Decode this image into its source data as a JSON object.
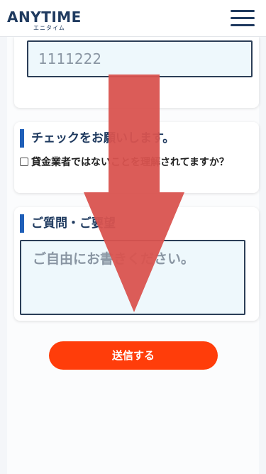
{
  "header": {
    "logo_main": "ANYTIME",
    "logo_sub": "エニタイム",
    "menu_icon": "hamburger-menu-icon"
  },
  "phone_field": {
    "value": "1111222"
  },
  "check_section": {
    "title": "チェックをお願いします。",
    "checkbox_label": "貸金業者ではないことを理解されてますか？"
  },
  "question_section": {
    "title": "ご質問・ご要望",
    "placeholder": "ご自由にお書きください。"
  },
  "submit": {
    "label": "送信する"
  },
  "overlay": {
    "arrow_icon": "down-arrow-icon",
    "color": "#d9534f"
  },
  "colors": {
    "brand": "#1f3a5f",
    "accent_bar": "#1f5fb8",
    "button": "#ff3d0a",
    "input_bg": "#eef8fc"
  }
}
